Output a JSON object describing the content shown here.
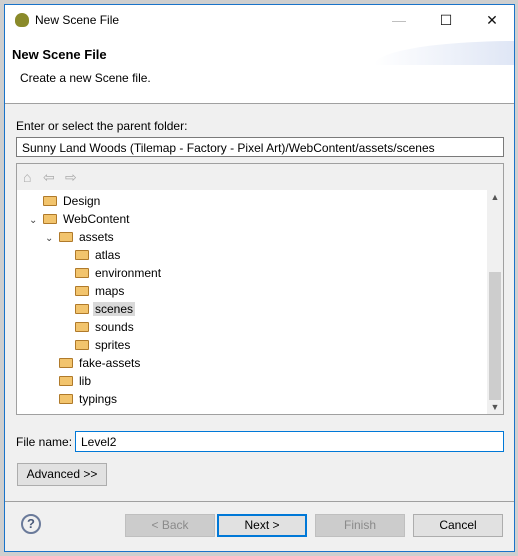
{
  "window": {
    "title": "New Scene File",
    "minimize": "—",
    "maximize": "☐",
    "close": "✕"
  },
  "header": {
    "title": "New Scene File",
    "description": "Create a new Scene file."
  },
  "parent_folder": {
    "label": "Enter or select the parent folder:",
    "value": "Sunny Land Woods (Tilemap - Factory - Pixel Art)/WebContent/assets/scenes"
  },
  "tree": {
    "toolbar": {
      "home": "⌂",
      "back": "⇦",
      "forward": "⇨"
    },
    "items": [
      {
        "label": "Design",
        "level": 1,
        "expanded": null
      },
      {
        "label": "WebContent",
        "level": 1,
        "expanded": true
      },
      {
        "label": "assets",
        "level": 2,
        "expanded": true
      },
      {
        "label": "atlas",
        "level": 3,
        "expanded": null
      },
      {
        "label": "environment",
        "level": 3,
        "expanded": null
      },
      {
        "label": "maps",
        "level": 3,
        "expanded": null
      },
      {
        "label": "scenes",
        "level": 3,
        "expanded": null,
        "selected": true
      },
      {
        "label": "sounds",
        "level": 3,
        "expanded": null
      },
      {
        "label": "sprites",
        "level": 3,
        "expanded": null
      },
      {
        "label": "fake-assets",
        "level": 2,
        "expanded": null
      },
      {
        "label": "lib",
        "level": 2,
        "expanded": null
      },
      {
        "label": "typings",
        "level": 2,
        "expanded": null
      }
    ]
  },
  "file_name": {
    "label": "File name:",
    "value": "Level2"
  },
  "buttons": {
    "advanced": "Advanced >>",
    "back": "< Back",
    "next": "Next >",
    "finish": "Finish",
    "cancel": "Cancel",
    "help": "?"
  }
}
